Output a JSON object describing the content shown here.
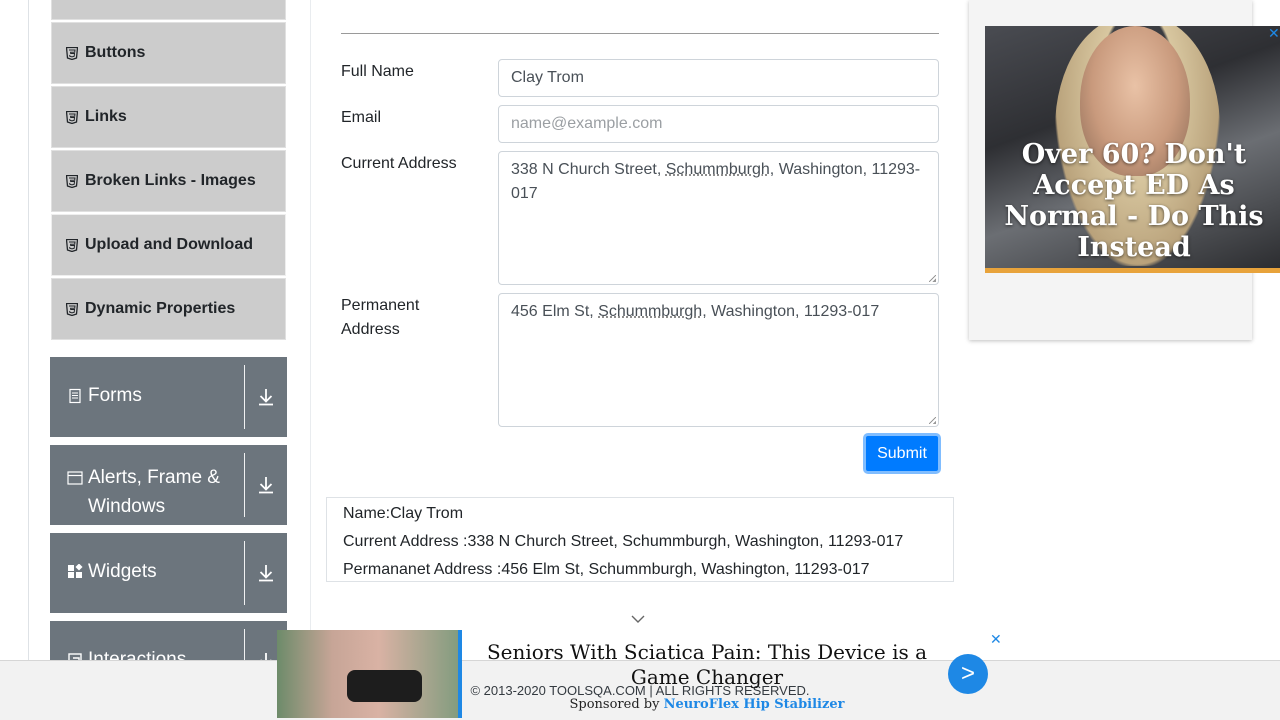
{
  "sidebar": {
    "items": [
      {
        "label": "Buttons"
      },
      {
        "label": "Links"
      },
      {
        "label": "Broken Links - Images"
      },
      {
        "label": "Upload and Download"
      },
      {
        "label": "Dynamic Properties"
      }
    ],
    "groups": [
      {
        "label": "Forms"
      },
      {
        "label": "Alerts, Frame & Windows"
      },
      {
        "label": "Widgets"
      },
      {
        "label": "Interactions"
      }
    ]
  },
  "form": {
    "full_name_label": "Full Name",
    "full_name_value": "Clay Trom",
    "email_label": "Email",
    "email_placeholder": "name@example.com",
    "current_address_label": "Current Address",
    "current_address_parts": [
      "338 N Church Street, ",
      "Schummburgh",
      ", Washington, 11293-017"
    ],
    "permanent_address_label_1": "Permanent",
    "permanent_address_label_2": "Address",
    "permanent_address_parts": [
      "456 Elm St, ",
      "Schummburgh",
      ", Washington, 11293-017"
    ],
    "submit_label": "Submit"
  },
  "output": {
    "name": "Name:Clay Trom",
    "current_address": "Current Address :338 N Church Street, Schummburgh, Washington, 11293-017",
    "permanent_address": "Permananet Address :456 Elm St, Schummburgh, Washington, 11293-017"
  },
  "ad_right": {
    "text": "Over 60? Don't Accept ED As Normal - Do This Instead",
    "close": "✕"
  },
  "ad_bottom": {
    "headline": "Seniors With Sciatica Pain: This Device is a Game Changer",
    "sponsor_prefix": "Sponsored by ",
    "sponsor_name": "NeuroFlex Hip Stabilizer",
    "go": ">",
    "close": "✕"
  },
  "footer": {
    "text": "© 2013-2020 TOOLSQA.COM | ALL RIGHTS RESERVED."
  },
  "colors": {
    "primary": "#007bff",
    "group_bg": "#6c757d",
    "item_bg": "#cccccc",
    "ad_accent": "#1e88e5"
  },
  "icons": [
    "html5-icon",
    "forms-icon",
    "window-icon",
    "widgets-icon",
    "interactions-icon",
    "download-arrow-icon",
    "chevron-down-icon",
    "close-icon"
  ]
}
